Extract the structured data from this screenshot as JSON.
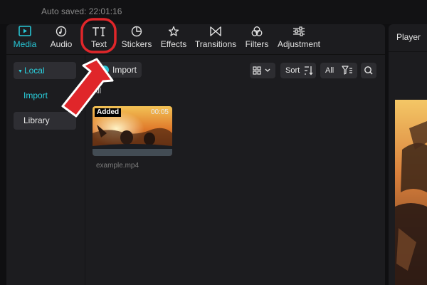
{
  "titlebar": {
    "autosave_text": "Auto saved: 22:01:16"
  },
  "tabs": [
    {
      "label": "Media",
      "icon": "media-icon",
      "active": true
    },
    {
      "label": "Audio",
      "icon": "audio-icon",
      "active": false
    },
    {
      "label": "Text",
      "icon": "text-icon",
      "active": false,
      "highlighted": true
    },
    {
      "label": "Stickers",
      "icon": "stickers-icon",
      "active": false
    },
    {
      "label": "Effects",
      "icon": "effects-icon",
      "active": false
    },
    {
      "label": "Transitions",
      "icon": "transitions-icon",
      "active": false
    },
    {
      "label": "Filters",
      "icon": "filters-icon",
      "active": false
    },
    {
      "label": "Adjustment",
      "icon": "adjustment-icon",
      "active": false
    }
  ],
  "sidebar": {
    "local_label": "Local",
    "import_label": "Import",
    "library_label": "Library"
  },
  "media": {
    "import_button_label": "Import",
    "view_icon": "grid-view-icon",
    "sort_label": "Sort",
    "filter_label": "All",
    "section_label": "All",
    "items": [
      {
        "badge": "Added",
        "duration": "00:05",
        "filename": "example.mp4"
      }
    ]
  },
  "player": {
    "title": "Player"
  },
  "annotation": {
    "color": "#e0262a",
    "target": "tab-text"
  },
  "colors": {
    "accent": "#27c7d6",
    "background": "#0f0f11",
    "panel": "#1c1c1f"
  }
}
